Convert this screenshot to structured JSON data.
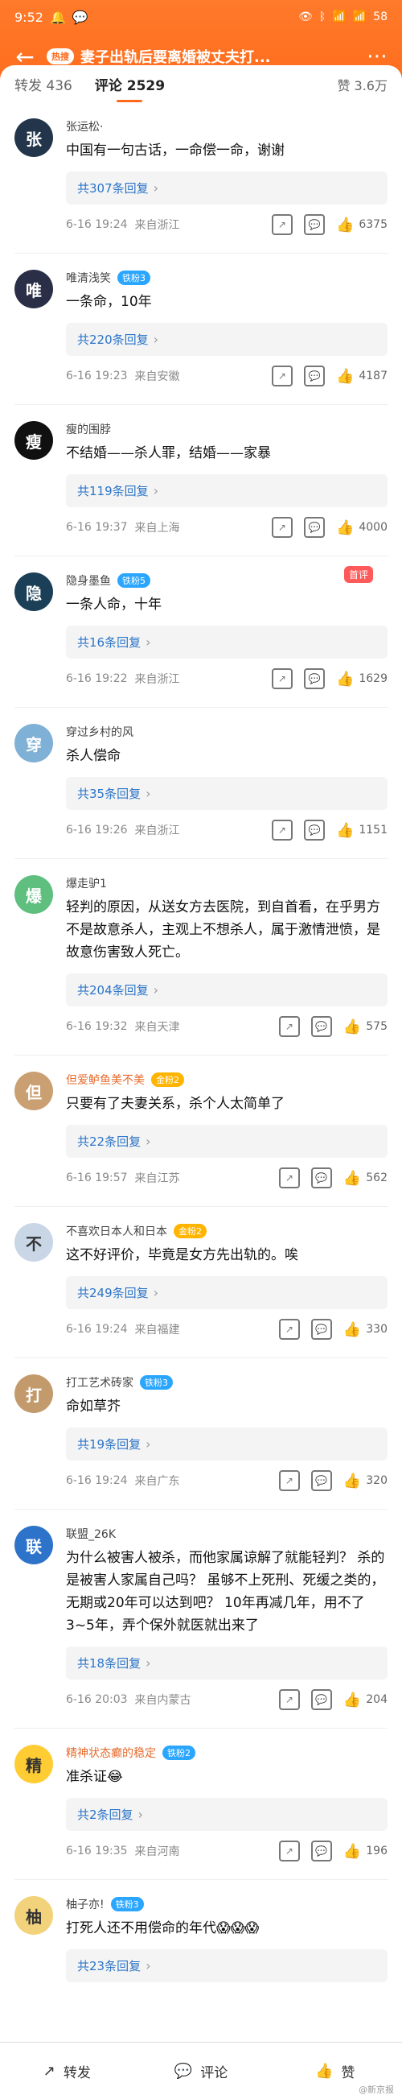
{
  "status_bar": {
    "time": "9:52",
    "right_text": "58"
  },
  "nav": {
    "badge": "热搜",
    "title": "妻子出轨后要离婚被丈夫打..."
  },
  "tabs": {
    "repost_label": "转发 436",
    "comment_label": "评论 2529",
    "like_label": "赞 3.6万"
  },
  "comments": [
    {
      "name": "张运松·",
      "level": "",
      "text": "中国有一句古话，一命偿一命，谢谢",
      "reply": "共307条回复",
      "time": "6-16 19:24",
      "location": "来自浙江",
      "likes": "6375",
      "avatar_color": "#22354a",
      "avatar_letter": "张"
    },
    {
      "name": "唯清浅笑",
      "level": "铁粉3",
      "text": "一条命，10年",
      "reply": "共220条回复",
      "time": "6-16 19:23",
      "location": "来自安徽",
      "likes": "4187",
      "avatar_color": "#2b2e47",
      "avatar_letter": "唯"
    },
    {
      "name": "瘦的围脖",
      "level": "",
      "text": "不结婚——杀人罪，结婚——家暴",
      "reply": "共119条回复",
      "time": "6-16 19:37",
      "location": "来自上海",
      "likes": "4000",
      "avatar_color": "#101010",
      "avatar_letter": "瘦"
    },
    {
      "name": "隐身墨鱼",
      "level": "铁粉5",
      "text": "一条人命，十年",
      "reply": "共16条回复",
      "time": "6-16 19:22",
      "location": "来自浙江",
      "likes": "1629",
      "avatar_color": "#1b3f57",
      "avatar_letter": "隐",
      "top_badge": "首评"
    },
    {
      "name": "穿过乡村的风",
      "level": "",
      "text": "杀人偿命",
      "reply": "共35条回复",
      "time": "6-16 19:26",
      "location": "来自浙江",
      "likes": "1151",
      "avatar_color": "#7fb0d6",
      "avatar_letter": "穿"
    },
    {
      "name": "爆走驴1",
      "level": "",
      "text": "轻判的原因，从送女方去医院，到自首看，在乎男方不是故意杀人，主观上不想杀人，属于激情泄愤，是故意伤害致人死亡。",
      "reply": "共204条回复",
      "time": "6-16 19:32",
      "location": "来自天津",
      "likes": "575",
      "avatar_color": "#5fbf7f",
      "avatar_letter": "爆"
    },
    {
      "name": "但爱鲈鱼美不美",
      "level": "金粉2",
      "text": "只要有了夫妻关系，杀个人太简单了",
      "reply": "共22条回复",
      "time": "6-16 19:57",
      "location": "来自江苏",
      "likes": "562",
      "avatar_color": "#caa073",
      "avatar_letter": "但",
      "gold": true
    },
    {
      "name": "不喜欢日本人和日本",
      "level": "金粉2",
      "text": "这不好评价，毕竟是女方先出轨的。唉",
      "reply": "共249条回复",
      "time": "6-16 19:24",
      "location": "来自福建",
      "likes": "330",
      "avatar_color": "#c9d6e6",
      "avatar_letter": "不",
      "gold": true
    },
    {
      "name": "打工艺术砖家",
      "level": "铁粉3",
      "text": "命如草芥",
      "reply": "共19条回复",
      "time": "6-16 19:24",
      "location": "来自广东",
      "likes": "320",
      "avatar_color": "#c39a6b",
      "avatar_letter": "打"
    },
    {
      "name": "联盟_26K",
      "level": "",
      "text": "为什么被害人被杀，而他家属谅解了就能轻判？ 杀的是被害人家属自己吗？ 虽够不上死刑、死缓之类的，无期或20年可以达到吧？ 10年再减几年，用不了3~5年，弄个保外就医就出来了",
      "reply": "共18条回复",
      "time": "6-16 20:03",
      "location": "来自内蒙古",
      "likes": "204",
      "avatar_color": "#2d73c9",
      "avatar_letter": "联"
    },
    {
      "name": "精神状态癫的稳定",
      "level": "铁粉2",
      "text": "准杀证😂",
      "reply": "共2条回复",
      "time": "6-16 19:35",
      "location": "来自河南",
      "likes": "196",
      "avatar_color": "#ffcc33",
      "avatar_letter": "精"
    },
    {
      "name": "柚子亦!",
      "level": "铁粉3",
      "text": "打死人还不用偿命的年代😱😱😱",
      "reply": "共23条回复",
      "time": "",
      "location": "",
      "likes": "",
      "avatar_color": "#f2d27a",
      "avatar_letter": "柚"
    }
  ],
  "bottom_bar": {
    "repost": "转发",
    "comment": "评论",
    "like": "赞"
  },
  "watermark": "@新京报"
}
